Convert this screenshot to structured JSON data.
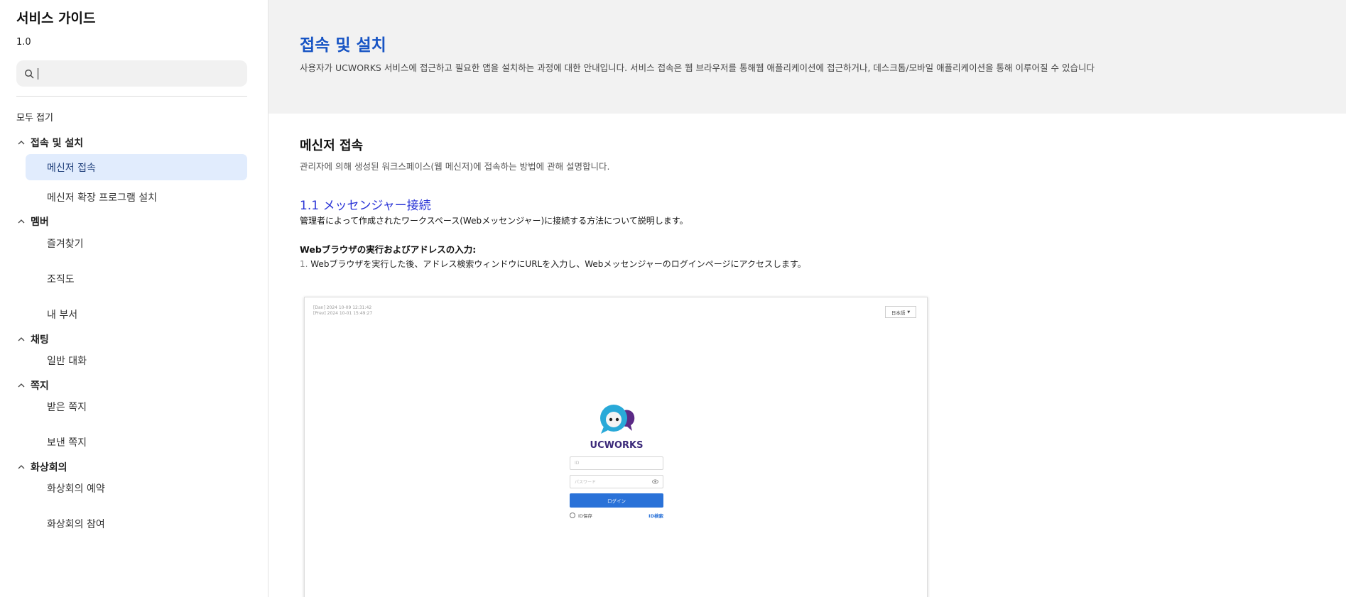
{
  "sidebar": {
    "title": "서비스 가이드",
    "version": "1.0",
    "search": {
      "value": "",
      "placeholder": ""
    },
    "collapse_all": "모두 접기",
    "groups": [
      {
        "label": "접속 및 설치",
        "items": [
          {
            "label": "메신저 접속",
            "active": true
          },
          {
            "label": "메신저 확장 프로그램 설치"
          }
        ]
      },
      {
        "label": "멤버",
        "items": [
          {
            "label": "즐겨찾기"
          },
          {
            "label": "조직도"
          },
          {
            "label": "내 부서"
          }
        ]
      },
      {
        "label": "채팅",
        "items": [
          {
            "label": "일반 대화"
          }
        ]
      },
      {
        "label": "쪽지",
        "items": [
          {
            "label": "받은 쪽지"
          },
          {
            "label": "보낸 쪽지"
          }
        ]
      },
      {
        "label": "화상회의",
        "items": [
          {
            "label": "화상회의 예약"
          },
          {
            "label": "화상회의 참여"
          }
        ]
      }
    ]
  },
  "hero": {
    "title": "접속 및 설치",
    "description": "사용자가 UCWORKS 서비스에 접근하고 필요한 앱을 설치하는 과정에 대한 안내입니다. 서비스 접속은 웹 브라우저를 통해웹 애플리케이션에 접근하거나, 데스크톱/모바일 애플리케이션을 통해 이루어질 수 있습니다"
  },
  "content": {
    "section_title": "메신저 접속",
    "section_desc": "관리자에 의해 생성된 워크스페이스(웹 메신저)에 접속하는 방법에 관해 설명합니다.",
    "sub_title": "1.1 メッセンジャー接続",
    "sub_desc": "管理者によって作成されたワークスペース(Webメッセンジャー)に接続する方法について説明します。",
    "step_title": "Webブラウザの実行およびアドレスの入力:",
    "step_num": "1.",
    "step_desc": " Webブラウザを実行した後、アドレス検索ウィンドウにURLを入力し、Webメッセンジャーのログインページにアクセスします。"
  },
  "figure": {
    "meta_line1": "[Dan] 2024 10-09 12:31:42",
    "meta_line2": "[Prev] 2024 10-01 15:49:27",
    "language": "日本語",
    "logo_text": "UCWORKS",
    "id_placeholder": "ID",
    "password_placeholder": "パスワード",
    "login_button": "ログイン",
    "remember_label": "ID保存",
    "find_id_link": "ID検索"
  },
  "colors": {
    "accent": "#1754c4",
    "active_bg": "#e1ecfd",
    "login_button": "#2a72d8",
    "logo_cyan": "#29a9d8",
    "logo_purple": "#5b2a86"
  }
}
